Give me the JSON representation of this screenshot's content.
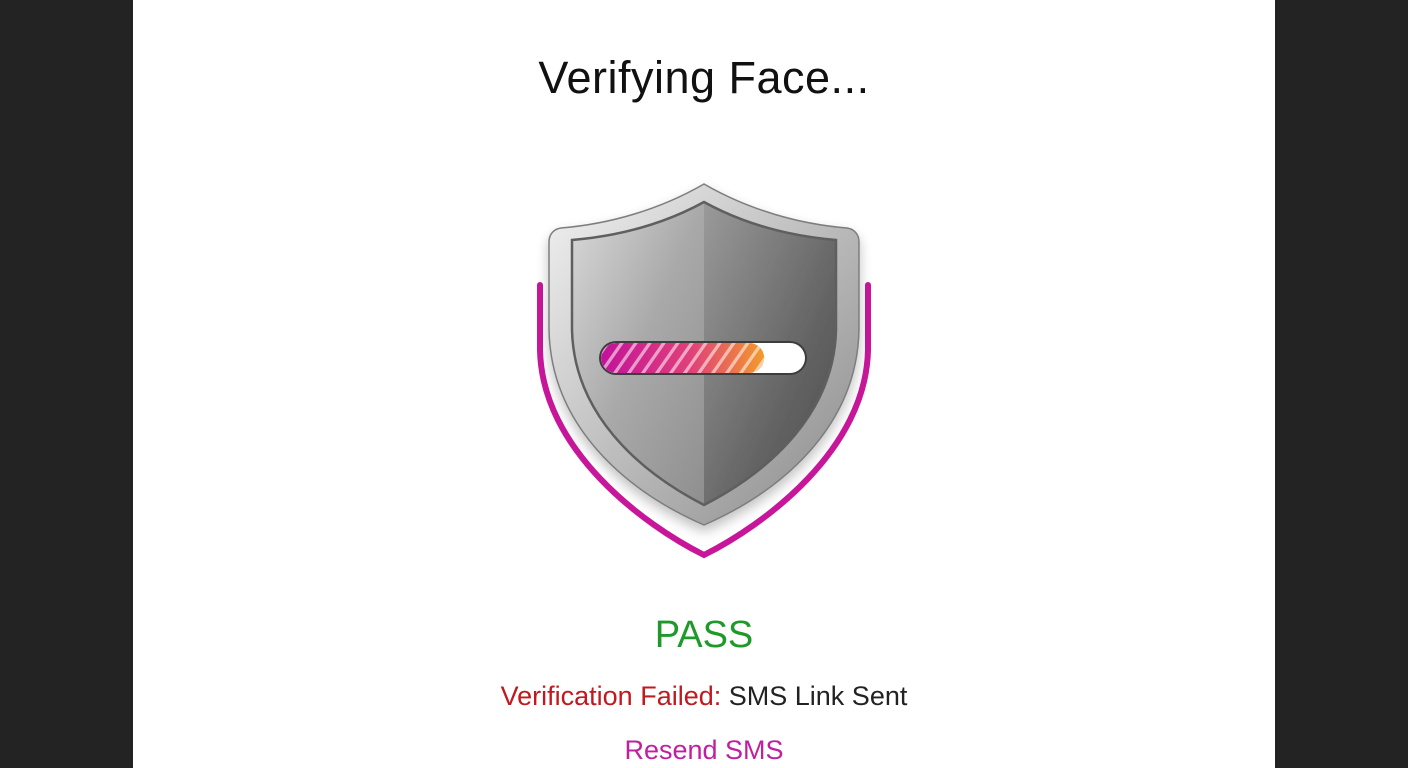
{
  "header": {
    "title": "Verifying Face..."
  },
  "verification": {
    "progress": 0.8,
    "result": "PASS",
    "status_label": "Verification Failed:",
    "status_message": "SMS Link Sent",
    "resend_label": "Resend SMS"
  },
  "icons": {
    "shield": "shield-icon"
  },
  "colors": {
    "page_background": "#ffffff",
    "outer_background": "#232323",
    "accent_magenta": "#c8169a",
    "pass_green": "#1f9a2a",
    "fail_red": "#c0191f",
    "progress_start": "#c2129a",
    "progress_end": "#f39a2b"
  }
}
